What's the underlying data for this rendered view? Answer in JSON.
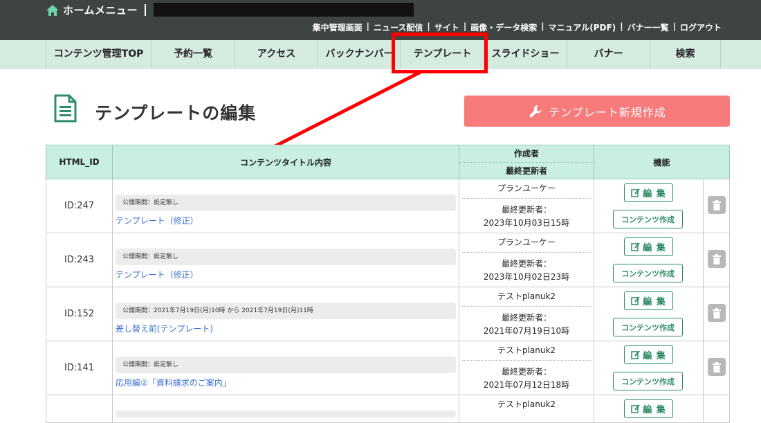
{
  "header": {
    "home_label": "ホームメニュー",
    "links": [
      "集中管理画面",
      "ニュース配信",
      "サイト",
      "画像・データ検索",
      "マニュアル(PDF)",
      "バナー一覧",
      "ログアウト"
    ]
  },
  "nav": {
    "items": [
      "コンテンツ管理TOP",
      "予約一覧",
      "アクセス",
      "バックナンバー",
      "テンプレート",
      "スライドショー",
      "バナー",
      "検索"
    ],
    "active": "テンプレート"
  },
  "page": {
    "title": "テンプレートの編集",
    "new_button": "テンプレート新規作成"
  },
  "table": {
    "headers": {
      "id": "HTML_ID",
      "content": "コンテンツタイトル内容",
      "author": "作成者",
      "updater": "最終更新者",
      "functions": "機能"
    },
    "rows": [
      {
        "id": "ID:247",
        "period": "公開期間：設定無し",
        "title": "テンプレート（修正）",
        "author": "プランユーケー",
        "updated_label": "最終更新者：",
        "updated_date": "2023年10月03日15時",
        "edit": "編 集",
        "content_btn": "コンテンツ作成"
      },
      {
        "id": "ID:243",
        "period": "公開期間：設定無し",
        "title": "テンプレート（修正）",
        "author": "プランユーケー",
        "updated_label": "最終更新者：",
        "updated_date": "2023年10月02日23時",
        "edit": "編 集",
        "content_btn": "コンテンツ作成"
      },
      {
        "id": "ID:152",
        "period": "公開期間：2021年7月19日(月)10時 から 2021年7月19日(月)11時",
        "title": "差し替え前(テンプレート)",
        "author": "テストplanuk2",
        "updated_label": "最終更新者：",
        "updated_date": "2021年07月19日10時",
        "edit": "編 集",
        "content_btn": "コンテンツ作成"
      },
      {
        "id": "ID:141",
        "period": "公開期間：設定無し",
        "title": "応用編②「資料請求のご案内」",
        "author": "テストplanuk2",
        "updated_label": "最終更新者：",
        "updated_date": "2021年07月12日18時",
        "edit": "編 集",
        "content_btn": "コンテンツ作成"
      },
      {
        "id": "",
        "period": "",
        "title": "",
        "author": "テストplanuk2",
        "updated_label": "",
        "updated_date": "",
        "edit": "編 集",
        "content_btn": ""
      }
    ]
  },
  "colors": {
    "highlight": "#ff0000",
    "accent_green": "#2a8a63",
    "new_button": "#f77b7b"
  }
}
